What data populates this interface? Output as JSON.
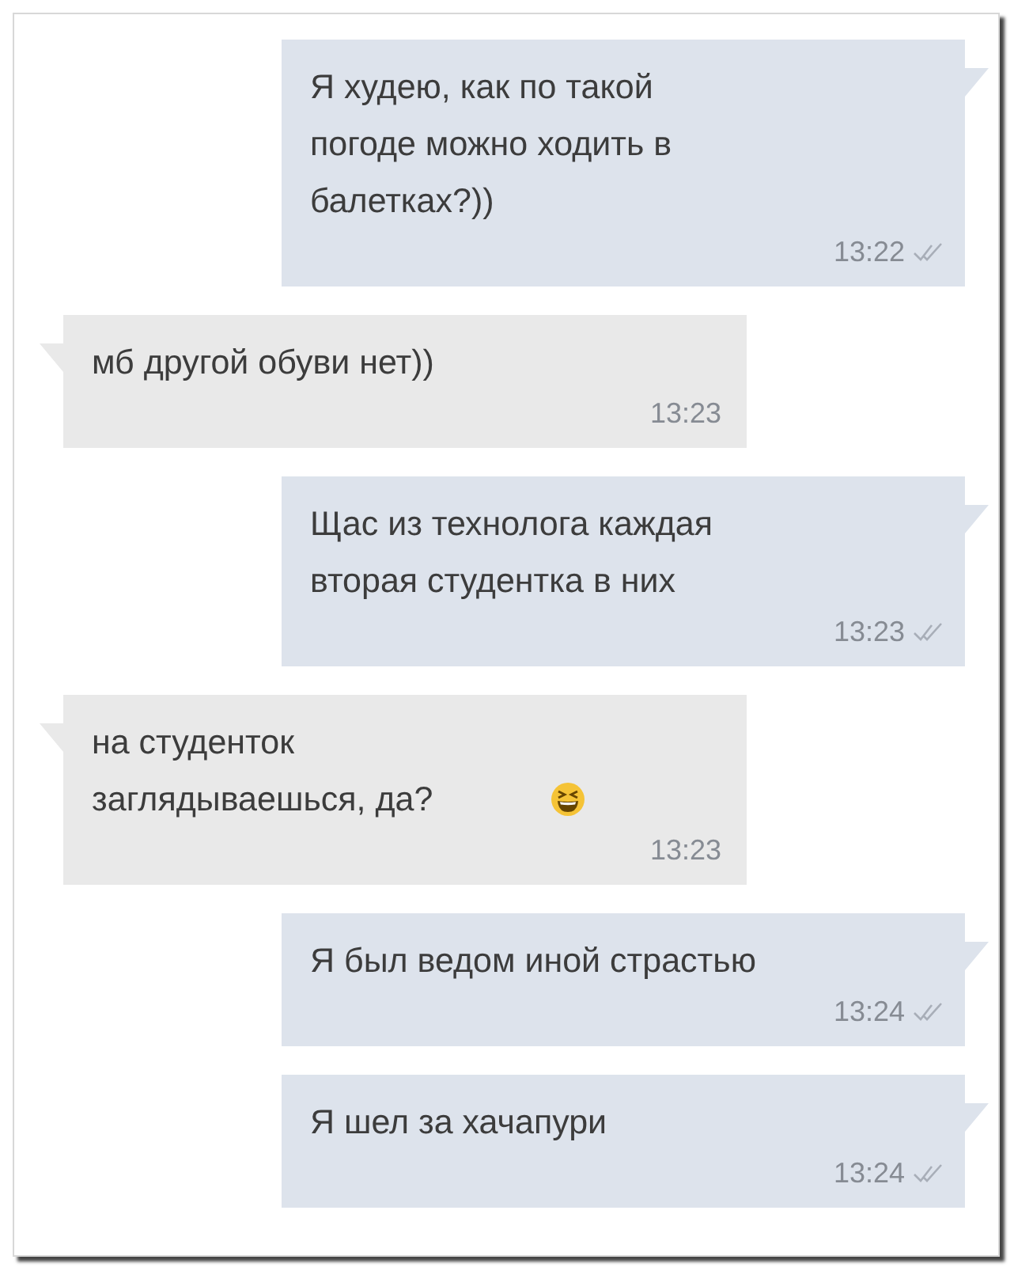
{
  "messages": [
    {
      "kind": "outgoing",
      "text": "Я худею, как по такой погоде можно ходить в балетках?))",
      "time": "13:22",
      "emoji": false
    },
    {
      "kind": "incoming",
      "text": "мб другой обуви нет))",
      "time": "13:23",
      "emoji": false
    },
    {
      "kind": "outgoing",
      "text": "Щас из технолога каждая вторая студентка в них",
      "time": "13:23",
      "emoji": false
    },
    {
      "kind": "incoming",
      "text": "на студенток заглядываешься, да?",
      "time": "13:23",
      "emoji": true
    },
    {
      "kind": "outgoing",
      "text": "Я был ведом иной страстью",
      "time": "13:24",
      "emoji": false
    },
    {
      "kind": "outgoing",
      "text": "Я шел за хачапури",
      "time": "13:24",
      "emoji": false
    }
  ]
}
